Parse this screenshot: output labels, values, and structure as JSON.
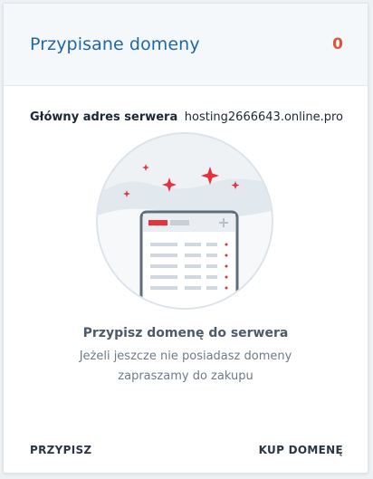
{
  "card": {
    "title": "Przypisane domeny",
    "count": "0"
  },
  "server": {
    "label": "Główny adres serwera",
    "value": "hosting2666643.online.pro"
  },
  "empty_state": {
    "icon": "domain-list-illustration",
    "title": "Przypisz domenę do serwera",
    "text": "Jeżeli jeszcze nie posiadasz domeny zapraszamy do zakupu"
  },
  "actions": {
    "assign_label": "PRZYPISZ",
    "buy_label": "KUP DOMENĘ"
  },
  "colors": {
    "title": "#1f67a8",
    "count": "#e0533a",
    "sparkle": "#e8303a"
  }
}
